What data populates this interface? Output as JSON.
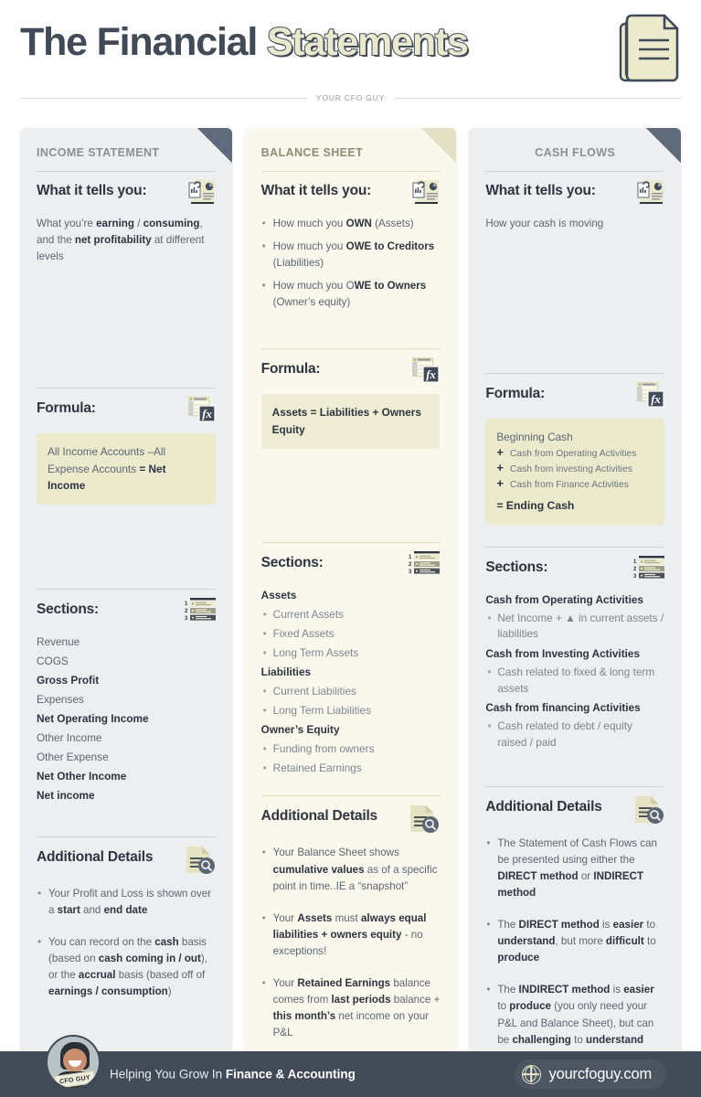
{
  "header": {
    "title_dark": "The Financial ",
    "title_highlight": "Statements",
    "rule_text": "YOUR CFO GUY"
  },
  "columns": [
    {
      "id": "income-statement",
      "title": "INCOME STATEMENT",
      "theme": "gray",
      "fold": "dark",
      "tells_heading": "What it tells you:",
      "tells_paragraph_html": "What you’re <b>earning</b> / <b>consuming</b>, and the <b>net profitability</b> at different levels",
      "tells_bullets": [],
      "formula_heading": "Formula:",
      "formula_html": "All Income Accounts –All Expense Accounts <b>= Net Income</b>",
      "formula_lines": [],
      "sections_heading": "Sections:",
      "sections": [
        {
          "text": "Revenue",
          "style": "plain"
        },
        {
          "text": "COGS",
          "style": "plain"
        },
        {
          "text": "Gross Profit",
          "style": "strong"
        },
        {
          "text": "Expenses",
          "style": "plain"
        },
        {
          "text": "Net Operating Income",
          "style": "strong"
        },
        {
          "text": "Other Income",
          "style": "plain"
        },
        {
          "text": "Other Expense",
          "style": "plain"
        },
        {
          "text": "Net Other Income",
          "style": "strong"
        },
        {
          "text": "Net income",
          "style": "strong"
        }
      ],
      "details_heading": "Additional Details",
      "details": [
        "Your Profit and Loss is shown over a <b>start</b> and <b>end date</b>",
        "You can record on the <b>cash</b> basis (based on <b>cash coming in / out</b>), or the <b>accrual</b> basis (based off of <b>earnings / consumption</b>)"
      ]
    },
    {
      "id": "balance-sheet",
      "title": "BALANCE SHEET",
      "theme": "cream",
      "fold": "light",
      "tells_heading": "What it tells you:",
      "tells_paragraph_html": "",
      "tells_bullets": [
        "How much you <b>OWN</b> (Assets)",
        "How much you <b>OWE to Creditors</b> (Liabilities)",
        "How much you O<b>WE to Owners</b> (Owner’s equity)"
      ],
      "formula_heading": "Formula:",
      "formula_html": "<b>Assets = Liabilities + Owners Equity</b>",
      "formula_lines": [],
      "sections_heading": "Sections:",
      "sections": [
        {
          "text": "Assets",
          "style": "strong"
        },
        {
          "text": "Current Assets",
          "style": "sub"
        },
        {
          "text": "Fixed Assets",
          "style": "sub"
        },
        {
          "text": "Long Term Assets",
          "style": "sub"
        },
        {
          "text": "Liabilities",
          "style": "strong"
        },
        {
          "text": "Current Liabilities",
          "style": "sub"
        },
        {
          "text": "Long Term Liabilities",
          "style": "sub"
        },
        {
          "text": "Owner’s Equity",
          "style": "strong"
        },
        {
          "text": "Funding from owners",
          "style": "sub"
        },
        {
          "text": "Retained Earnings",
          "style": "sub"
        }
      ],
      "details_heading": "Additional Details",
      "details": [
        "Your Balance Sheet shows <b>cumulative values</b> as of a specific point in time..IE a “snapshot”",
        "Your <b>Assets</b> must <b>always equal liabilities + owners equity</b> - no exceptions!",
        "Your <b>Retained Earnings</b> balance comes from <b>last periods</b> balance + <b>this month’s</b> net income on your P&amp;L"
      ]
    },
    {
      "id": "cash-flows",
      "title": "CASH FLOWS",
      "theme": "gray",
      "fold": "dark",
      "tells_heading": "What it tells you:",
      "tells_paragraph_html": "How your cash is moving",
      "tells_bullets": [],
      "formula_heading": "Formula:",
      "formula_html": "",
      "formula_lines": [
        {
          "prefix": "",
          "text": "Beginning Cash",
          "style": "first"
        },
        {
          "prefix": "+",
          "text": "Cash from Operating Activities",
          "style": "plus"
        },
        {
          "prefix": "+",
          "text": "Cash from investing Activities",
          "style": "plus"
        },
        {
          "prefix": "+",
          "text": "Cash from Finance Activities",
          "style": "plus"
        },
        {
          "prefix": "=",
          "text": "Ending Cash",
          "style": "equals"
        }
      ],
      "sections_heading": "Sections:",
      "sections": [
        {
          "text": "Cash from Operating Activities",
          "style": "strong"
        },
        {
          "text": "Net Income + ▲ in current assets / liabilities",
          "style": "subwrap"
        },
        {
          "text": "Cash from Investing Activities",
          "style": "strong"
        },
        {
          "text": "Cash related to fixed &amp; long term assets",
          "style": "subwrap"
        },
        {
          "text": "Cash from financing Activities",
          "style": "strong"
        },
        {
          "text": "Cash related to debt / equity raised / paid",
          "style": "subwrap"
        }
      ],
      "details_heading": "Additional Details",
      "details": [
        "The Statement of Cash Flows can be presented using either the <b>DIRECT method</b> or <b>INDIRECT method</b>",
        "The <b>DIRECT method</b> is <b>easier</b> to <b>understand</b>, but more <b>difficult</b> to <b>produce</b>",
        "The <b>INDIRECT method</b> is <b>easier</b> to <b>produce</b> (you only need your P&amp;L and Balance Sheet), but can be <b>challenging</b> to <b>understand</b>"
      ]
    }
  ],
  "footer": {
    "tagline_plain": "Helping You Grow In ",
    "tagline_bold": "Finance & Accounting",
    "website": "yourcfoguy.com",
    "avatar_badge": "CFO GUY"
  },
  "colors": {
    "dark_slate": "#414b58",
    "cream": "#faf8ec",
    "gray_card": "#eceef0",
    "formula_box": "#eceacd",
    "body_text": "#5c6672",
    "heading_text": "#2e3440"
  }
}
